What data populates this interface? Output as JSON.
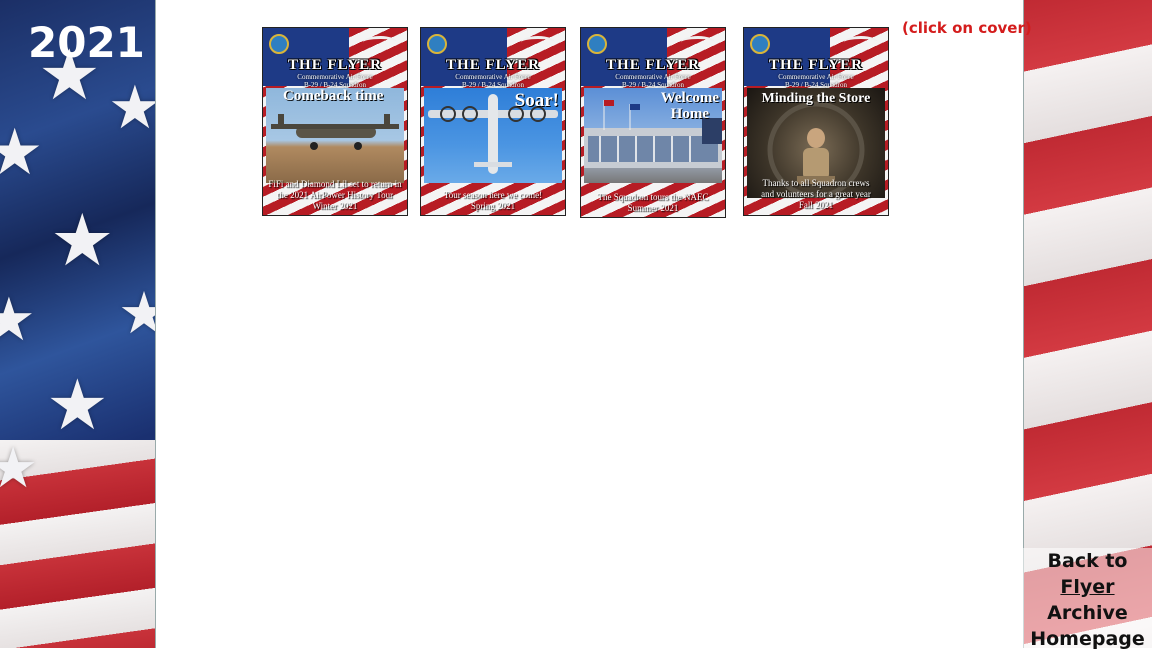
{
  "page": {
    "year": "2021",
    "click_note": "(click on cover)"
  },
  "covers": [
    {
      "masthead": "THE FLYER",
      "sub1": "Commemorative Air Force",
      "sub2": "B-29 / B-24 Squadron",
      "headline": "Comeback time",
      "caption1": "FiFi and Diamond Lil set to return in",
      "caption2": "the 2021 AirPower History Tour",
      "issue": "Winter 2021"
    },
    {
      "masthead": "THE FLYER",
      "sub1": "Commemorative Air Force",
      "sub2": "B-29 / B-24 Squadron",
      "headline": "Soar!",
      "caption1": "Tour season here we come!",
      "caption2": "",
      "issue": "Spring 2021"
    },
    {
      "masthead": "THE FLYER",
      "sub1": "Commemorative Air Force",
      "sub2": "B-29 / B-24 Squadron",
      "headline1": "Welcome",
      "headline2": "Home",
      "caption1": "The Squadron tours the NAEC",
      "caption2": "",
      "issue": "Summer 2021"
    },
    {
      "masthead": "THE FLYER",
      "sub1": "Commemorative Air Force",
      "sub2": "B-29 / B-24 Squadron",
      "headline": "Minding the Store",
      "caption1": "Thanks to all Squadron crews",
      "caption2": "and volunteers for a great year",
      "issue": "Fall 2021"
    }
  ],
  "back_link": {
    "line1": "Back to",
    "word_flyer": "Flyer",
    "word_archive": "Archive",
    "line3": "Homepage"
  },
  "colors": {
    "accent_red": "#d41c1c",
    "flag_blue": "#1e3a86",
    "flag_red": "#b71c24"
  },
  "icons": [
    "star-icon",
    "squadron-logo-icon",
    "wings-icon"
  ]
}
